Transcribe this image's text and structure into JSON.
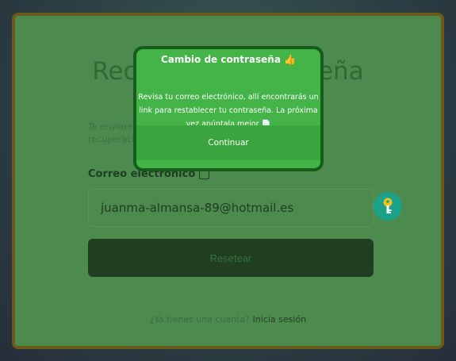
{
  "page": {
    "title": "Recuperar contraseña",
    "description": "Te enviaremos un email con las instrucciones para recuperación de correo que…",
    "email_label": "Correo electrónico",
    "email_value": "juanma-almansa-89@hotmail.es",
    "reset_label": "Resetear",
    "footer_text": "¿Ya tienes una cuenta?",
    "footer_link": "Inicia sesión"
  },
  "modal": {
    "title": "Cambio de contraseña 👍",
    "message": "Revisa tu correo electrónico, allí encontrarás un link para restablecer tu contraseña. La próxima vez apúntala mejor 📄",
    "continue_label": "Continuar"
  },
  "icons": {
    "key_button": "key-icon",
    "label_checkbox": "checkbox-icon"
  },
  "colors": {
    "card": "#4d8a4e",
    "modal": "#44b449",
    "key_button": "#19a288",
    "reset_button": "#1f3f20"
  }
}
